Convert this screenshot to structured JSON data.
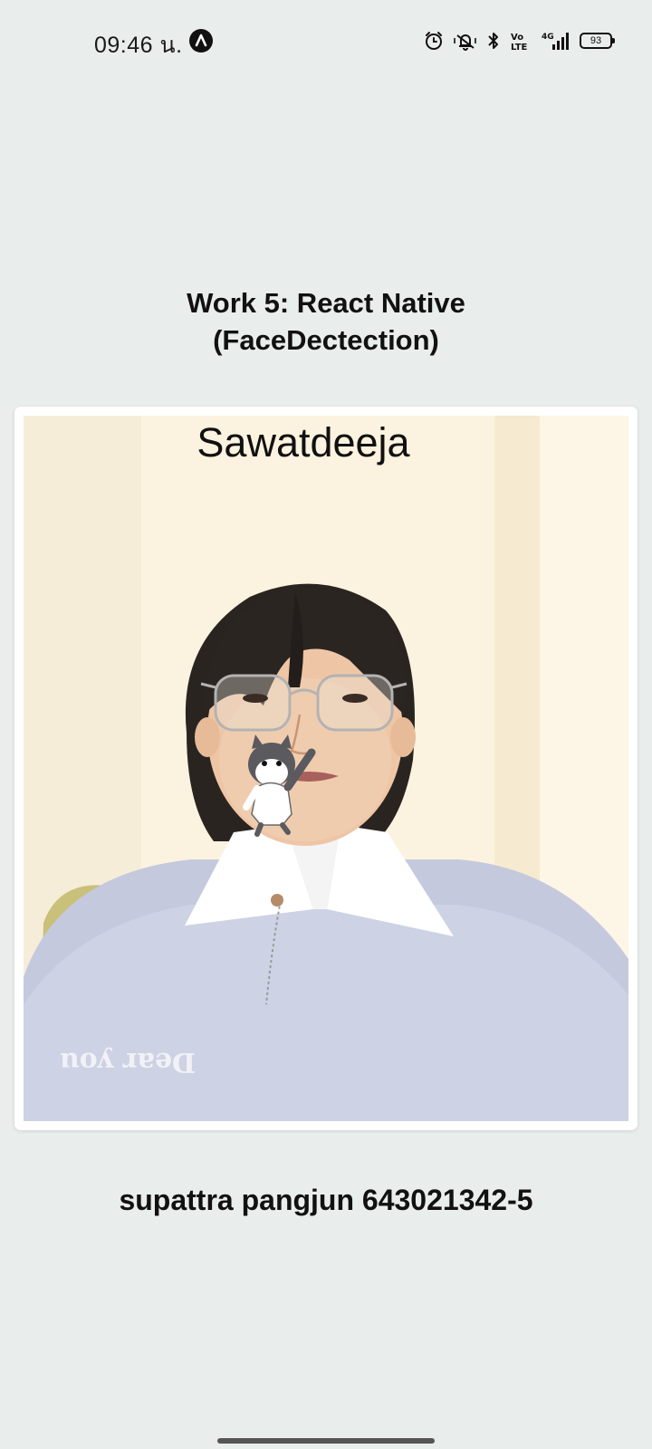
{
  "status_bar": {
    "time": "09:46 น.",
    "battery": "93",
    "icons": [
      "nav-status-icon",
      "alarm-icon",
      "vibrate-icon",
      "bluetooth-icon",
      "volte-icon",
      "signal-4g-icon",
      "battery-icon"
    ],
    "volte_label": "Vo LTE",
    "network_label": "4G"
  },
  "header": {
    "title_line1": "Work 5: React Native",
    "title_line2": "(FaceDectection)"
  },
  "camera": {
    "overlay_text": "Sawatdeeja",
    "sticker_icon": "dancing-husky-sticker",
    "shirt_text": "Dear you"
  },
  "footer": {
    "credit": "supattra pangjun 643021342-5"
  },
  "colors": {
    "background": "#e9edec",
    "card": "#ffffff",
    "text": "#111111"
  }
}
